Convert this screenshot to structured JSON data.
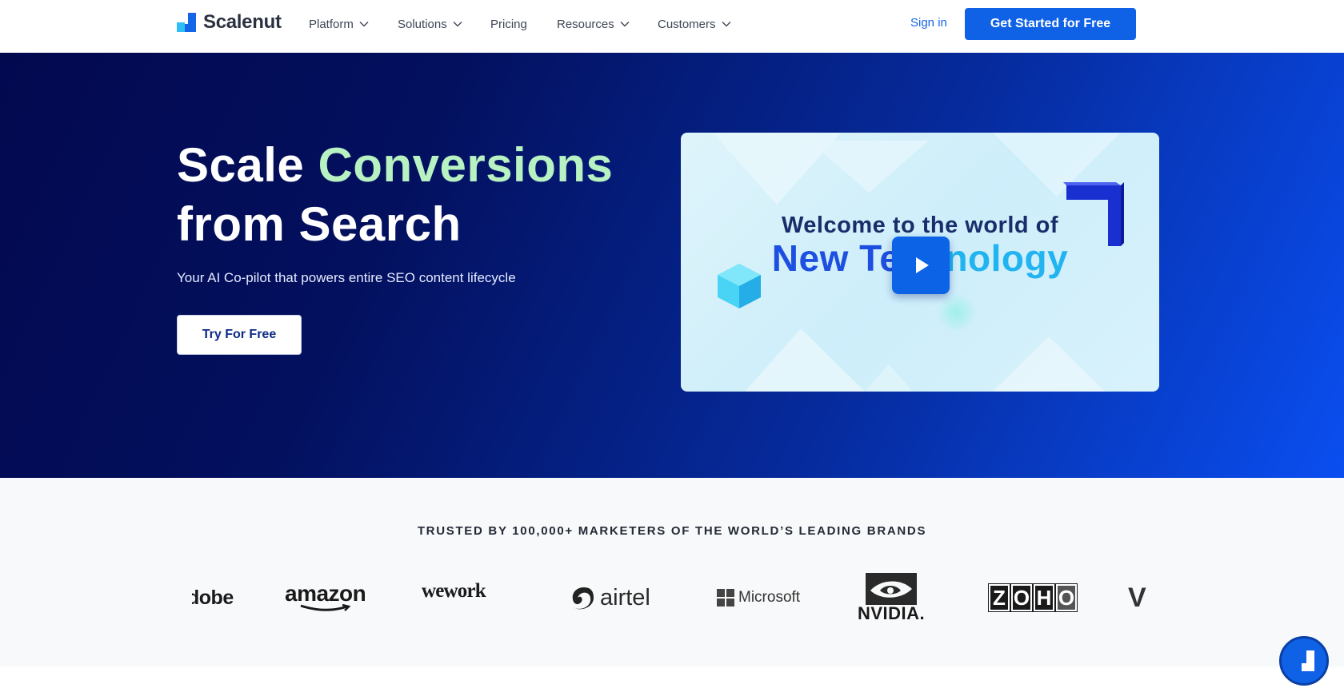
{
  "brand": {
    "name": "Scalenut"
  },
  "nav": {
    "items": [
      {
        "label": "Platform",
        "has_dropdown": true
      },
      {
        "label": "Solutions",
        "has_dropdown": true
      },
      {
        "label": "Pricing",
        "has_dropdown": false
      },
      {
        "label": "Resources",
        "has_dropdown": true
      },
      {
        "label": "Customers",
        "has_dropdown": true
      }
    ],
    "signin_label": "Sign in",
    "cta_label": "Get Started for Free"
  },
  "hero": {
    "title_word1": "Scale",
    "title_highlight": "Conversions",
    "title_line2": "from Search",
    "subtitle": "Your AI Co-pilot that powers entire SEO content lifecycle",
    "cta_label": "Try For Free",
    "video": {
      "line1": "Welcome to the world of",
      "line2_part1": "New Te",
      "line2_part2": "nology"
    }
  },
  "trusted": {
    "title": "TRUSTED BY 100,000+ MARKETERS OF THE WORLD’S LEADING BRANDS",
    "brands": [
      "dobe",
      "amazon",
      "wework",
      "airtel",
      "Microsoft",
      "NVIDIA.",
      "ZOHO",
      "V"
    ]
  },
  "colors": {
    "primary": "#0f62e6",
    "hero_dark": "#03094f",
    "highlight": "#b8f1c2"
  },
  "icons": {
    "dropdown": "chevron-down-icon",
    "play": "play-icon",
    "chat": "chat-widget-icon"
  }
}
